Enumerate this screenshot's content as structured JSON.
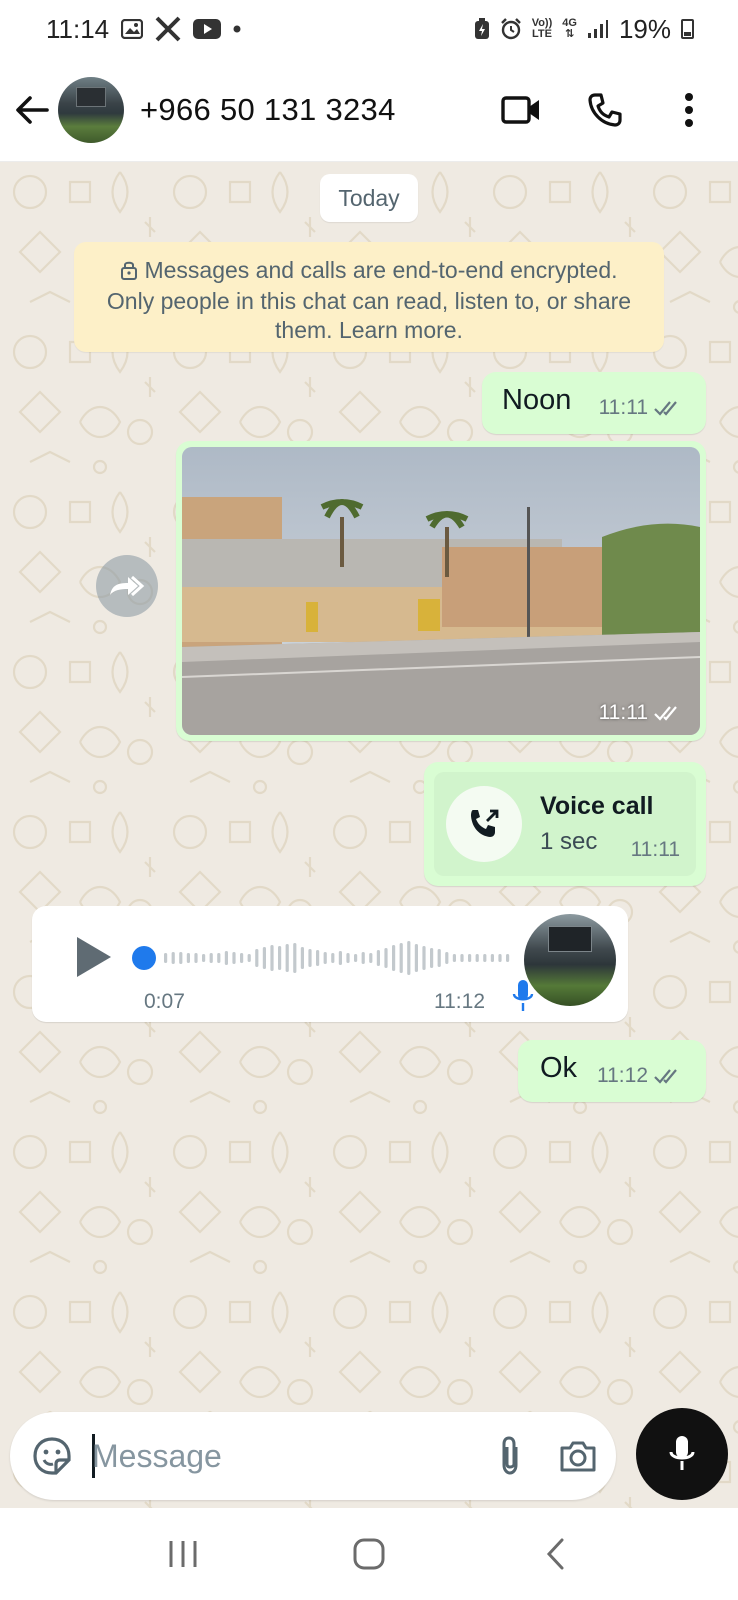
{
  "status_bar": {
    "time": "11:14",
    "network_volte": "Vo))",
    "network_lte": "LTE",
    "network_4g": "4G",
    "battery_percent": "19%"
  },
  "header": {
    "contact_name": "+966 50 131 3234",
    "icons": [
      "back-arrow-icon",
      "video-call-icon",
      "phone-icon",
      "more-vertical-icon"
    ]
  },
  "chat": {
    "date_chip": "Today",
    "encryption_notice": "Messages and calls are end-to-end encrypted. Only people in this chat can read, listen to, or share them. Learn more.",
    "messages": [
      {
        "type": "text",
        "direction": "outgoing",
        "text": "Noon",
        "time": "11:11",
        "status": "read"
      },
      {
        "type": "image",
        "direction": "outgoing",
        "time": "11:11",
        "status": "read"
      },
      {
        "type": "voice_call",
        "direction": "outgoing",
        "title": "Voice call",
        "duration": "1 sec",
        "time": "11:11"
      },
      {
        "type": "voice_note",
        "direction": "incoming",
        "duration": "0:07",
        "time": "11:12",
        "progress": 0
      },
      {
        "type": "text",
        "direction": "outgoing",
        "text": "Ok",
        "time": "11:12",
        "status": "read"
      }
    ]
  },
  "composer": {
    "placeholder": "Message",
    "icons": [
      "sticker-icon",
      "attach-icon",
      "camera-icon",
      "mic-icon"
    ]
  },
  "navbar": {
    "icons": [
      "recents-icon",
      "home-icon",
      "back-icon"
    ]
  },
  "colors": {
    "outgoing_bubble": "#d9fdd3",
    "incoming_bubble": "#ffffff",
    "chat_background": "#efeae2",
    "encryption_banner": "#fdf0c8",
    "accent_blue": "#1f7aec"
  }
}
